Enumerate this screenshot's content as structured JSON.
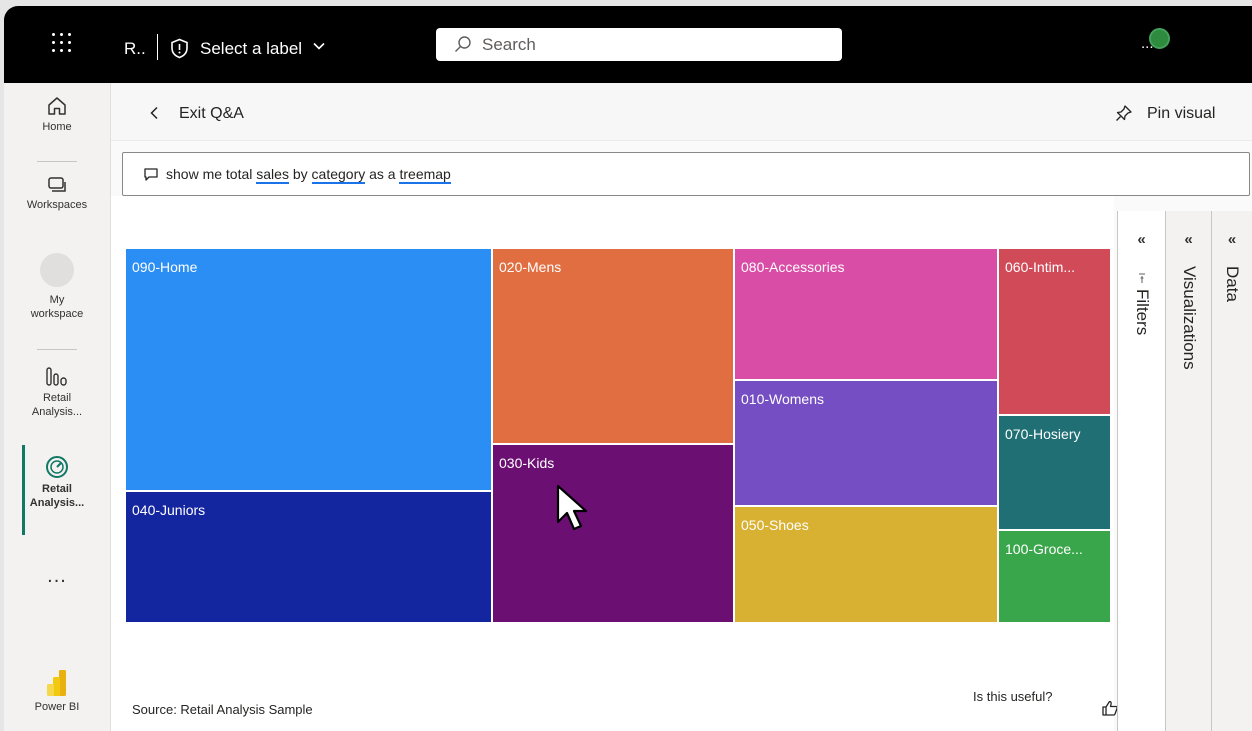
{
  "topbar": {
    "report_name": "R..",
    "label_text": "Select a label",
    "search_placeholder": "Search",
    "account_overflow": "..."
  },
  "leftnav": {
    "items": [
      {
        "label": "Home",
        "icon": "home-icon"
      },
      {
        "label": "Workspaces",
        "icon": "workspaces-icon"
      },
      {
        "label": "My workspace",
        "icon": "my-workspace-icon"
      },
      {
        "label": "Retail Analysis...",
        "icon": "report-icon"
      },
      {
        "label": "Retail Analysis...",
        "icon": "dashboard-icon",
        "active": true
      },
      {
        "label": "...",
        "icon": "more-icon"
      }
    ],
    "brand_label": "Power BI"
  },
  "header": {
    "exit_label": "Exit Q&A",
    "pin_label": "Pin visual"
  },
  "qna": {
    "segments": [
      {
        "text": "show me total ",
        "underline": false
      },
      {
        "text": "sales",
        "underline": true
      },
      {
        "text": " by ",
        "underline": false
      },
      {
        "text": "category",
        "underline": true
      },
      {
        "text": " as a ",
        "underline": false
      },
      {
        "text": "treemap",
        "underline": true
      }
    ]
  },
  "chart_data": {
    "type": "treemap",
    "title": "",
    "metric": "total sales",
    "items": [
      {
        "category": "090-Home",
        "color": "#2b8ef5"
      },
      {
        "category": "040-Juniors",
        "color": "#1425a0"
      },
      {
        "category": "020-Mens",
        "color": "#e06e41"
      },
      {
        "category": "030-Kids",
        "color": "#6b0f73"
      },
      {
        "category": "080-Accessories",
        "color": "#d94da6"
      },
      {
        "category": "010-Womens",
        "color": "#744ec2"
      },
      {
        "category": "050-Shoes",
        "color": "#d8b132"
      },
      {
        "category": "060-Intim...",
        "color": "#d04a57"
      },
      {
        "category": "070-Hosiery",
        "color": "#1f6f75"
      },
      {
        "category": "100-Groce...",
        "color": "#3aa64b"
      }
    ]
  },
  "footer": {
    "source": "Source: Retail Analysis Sample",
    "useful_prompt": "Is this useful?"
  },
  "panes": {
    "filters": "Filters",
    "visualizations": "Visualizations",
    "data": "Data",
    "collapse_glyph": "«"
  }
}
